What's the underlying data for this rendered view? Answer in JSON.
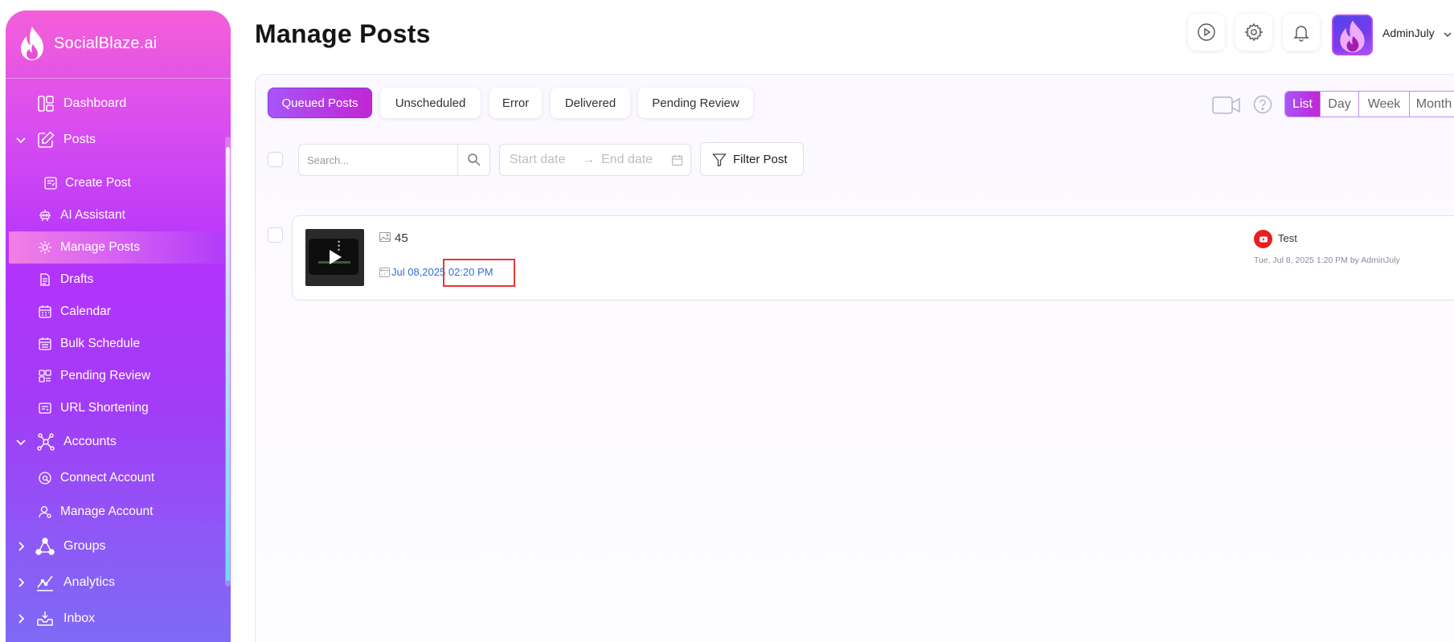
{
  "app": {
    "name": "SocialBlaze.ai"
  },
  "sidebar": {
    "items": [
      {
        "label": "Dashboard",
        "icon": "dashboard-icon"
      },
      {
        "label": "Posts",
        "icon": "posts-icon",
        "expanded": true
      },
      {
        "label": "Create Post",
        "icon": "create-post-icon"
      },
      {
        "label": "AI Assistant",
        "icon": "ai-assistant-icon"
      },
      {
        "label": "Manage Posts",
        "icon": "manage-posts-icon",
        "active": true
      },
      {
        "label": "Drafts",
        "icon": "drafts-icon"
      },
      {
        "label": "Calendar",
        "icon": "calendar-icon"
      },
      {
        "label": "Bulk Schedule",
        "icon": "bulk-schedule-icon"
      },
      {
        "label": "Pending Review",
        "icon": "pending-review-icon"
      },
      {
        "label": "URL Shortening",
        "icon": "url-shortening-icon"
      },
      {
        "label": "Accounts",
        "icon": "accounts-icon",
        "expanded": true
      },
      {
        "label": "Connect Account",
        "icon": "connect-account-icon"
      },
      {
        "label": "Manage Account",
        "icon": "manage-account-icon"
      },
      {
        "label": "Groups",
        "icon": "groups-icon",
        "expanded": false
      },
      {
        "label": "Analytics",
        "icon": "analytics-icon",
        "expanded": false
      },
      {
        "label": "Inbox",
        "icon": "inbox-icon",
        "expanded": false
      }
    ]
  },
  "header": {
    "title": "Manage Posts",
    "user_name": "AdminJuly"
  },
  "tabs": [
    {
      "label": "Queued Posts",
      "active": true
    },
    {
      "label": "Unscheduled"
    },
    {
      "label": "Error"
    },
    {
      "label": "Delivered"
    },
    {
      "label": "Pending Review"
    }
  ],
  "views": [
    {
      "label": "List",
      "active": true
    },
    {
      "label": "Day"
    },
    {
      "label": "Week"
    },
    {
      "label": "Month"
    }
  ],
  "filters": {
    "search_placeholder": "Search...",
    "start_placeholder": "Start date",
    "end_placeholder": "End date",
    "arrow": "→",
    "filter_label": "Filter Post"
  },
  "post": {
    "count": "45",
    "date": "Jul 08,2025 02:20 PM",
    "account_name": "Test",
    "meta": "Tue, Jul 8, 2025 1:20 PM by AdminJuly",
    "platform": "youtube"
  },
  "colors": {
    "accent": "#b233fb",
    "sidebar_top": "#f45fd7",
    "sidebar_bottom": "#7c6cf5",
    "link": "#2f6fd6",
    "highlight_box": "#e53935",
    "youtube": "#e91e1e"
  }
}
